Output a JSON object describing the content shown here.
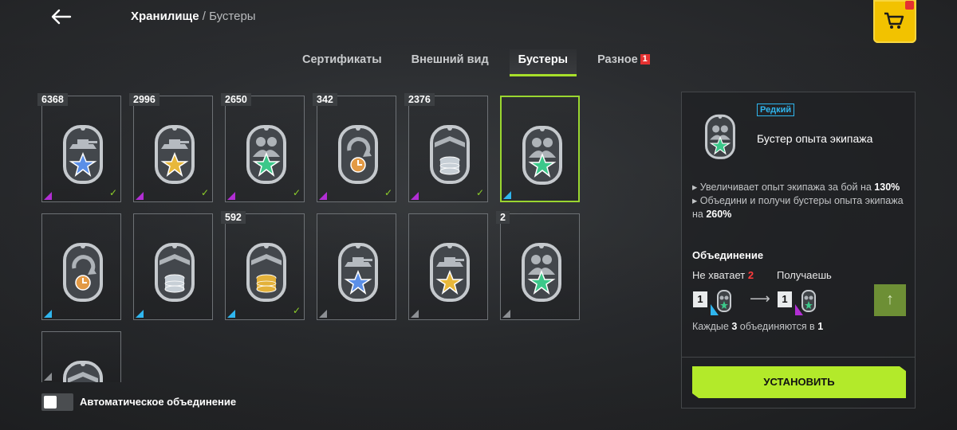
{
  "header": {
    "breadcrumb_current": "Хранилище",
    "breadcrumb_sep": "/",
    "breadcrumb_sub": "Бустеры"
  },
  "tabs": [
    {
      "label": "Сертификаты",
      "active": false
    },
    {
      "label": "Внешний вид",
      "active": false
    },
    {
      "label": "Бустеры",
      "active": true
    },
    {
      "label": "Разное",
      "active": false,
      "count": "1"
    }
  ],
  "colors": {
    "accent": "#a8e02a",
    "rare": "#2fb6ef",
    "epic": "#b22ed4",
    "common": "#8d9094",
    "alert": "#e53131"
  },
  "boosters": [
    {
      "count": "6368",
      "emblem": "tank",
      "star": "#5b8fe8",
      "rarity": "epic",
      "checked": true
    },
    {
      "count": "2996",
      "emblem": "tank",
      "star": "#e8b83a",
      "rarity": "epic",
      "checked": true
    },
    {
      "count": "2650",
      "emblem": "crew",
      "star": "#3cc88a",
      "rarity": "epic",
      "checked": true
    },
    {
      "count": "342",
      "emblem": "cycle",
      "star": "#e39a45",
      "rarity": "epic",
      "checked": true
    },
    {
      "count": "2376",
      "emblem": "coins",
      "star": "#c7cfd6",
      "rarity": "epic",
      "checked": true
    },
    {
      "count": "",
      "emblem": "crew",
      "star": "#3cc88a",
      "rarity": "rare",
      "checked": false,
      "selected": true
    },
    {
      "count": "",
      "emblem": "cycle",
      "star": "#e39a45",
      "rarity": "rare",
      "checked": false
    },
    {
      "count": "",
      "emblem": "coins",
      "star": "#c7cfd6",
      "rarity": "rare",
      "checked": false
    },
    {
      "count": "592",
      "emblem": "coins",
      "star": "#e3b13a",
      "rarity": "rare",
      "checked": true
    },
    {
      "count": "",
      "emblem": "tank",
      "star": "#5b8fe8",
      "rarity": "common",
      "checked": false
    },
    {
      "count": "",
      "emblem": "tank",
      "star": "#e8b83a",
      "rarity": "common",
      "checked": false
    },
    {
      "count": "2",
      "emblem": "crew",
      "star": "#3cc88a",
      "rarity": "common",
      "checked": false
    },
    {
      "count": "",
      "emblem": "coins",
      "star": "#c7cfd6",
      "rarity": "common",
      "checked": false
    }
  ],
  "details": {
    "rarity_label": "Редкий",
    "name": "Бустер опыта экипажа",
    "line1_text": "Увеличивает опыт экипажа за бой на",
    "line1_value": "130%",
    "line2_text": "Объедини и получи бустеры опыта экипажа на",
    "line2_value": "260%",
    "merge_title": "Объединение",
    "lacking_label": "Не хватает",
    "lacking_value": "2",
    "receive_label": "Получаешь",
    "have_qty": "1",
    "get_qty": "1",
    "every_prefix": "Каждые",
    "every_count": "3",
    "every_mid": "объединяются в",
    "every_result": "1",
    "install_label": "УСТАНОВИТЬ"
  },
  "auto_merge": {
    "label": "Автоматическое объединение",
    "enabled": false
  }
}
